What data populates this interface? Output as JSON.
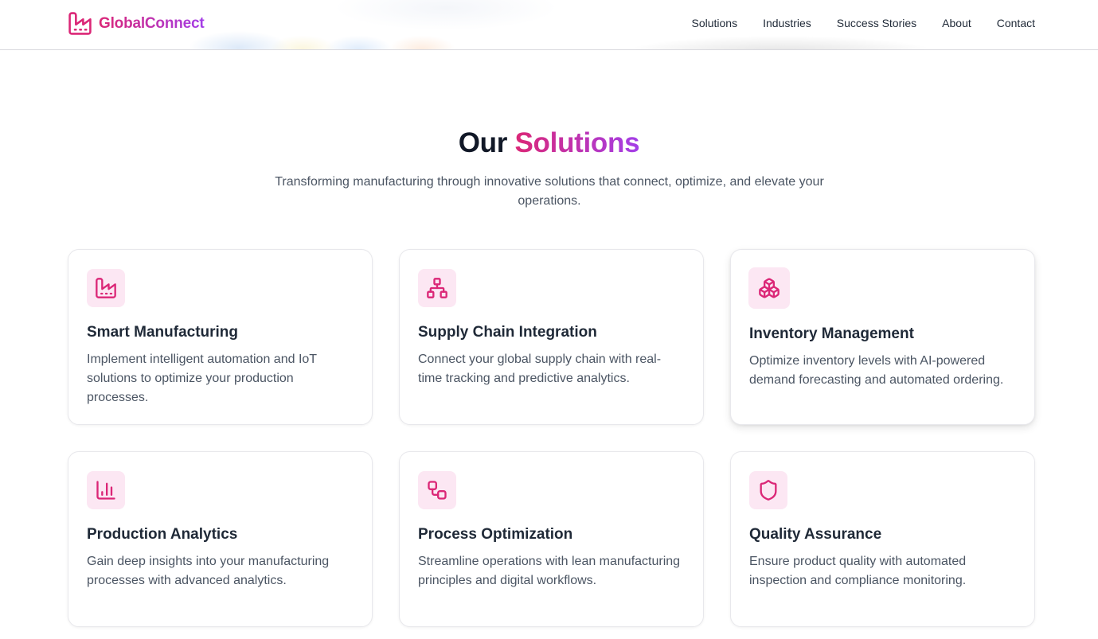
{
  "brand": {
    "name": "GlobalConnect",
    "accent_from": "#db2777",
    "accent_to": "#a33ee8",
    "icon": "factory-icon"
  },
  "nav": {
    "items": [
      {
        "label": "Solutions"
      },
      {
        "label": "Industries"
      },
      {
        "label": "Success Stories"
      },
      {
        "label": "About"
      },
      {
        "label": "Contact"
      }
    ]
  },
  "section": {
    "title_lead": "Our",
    "title_accent": "Solutions",
    "subtitle": "Transforming manufacturing through innovative solutions that connect, optimize, and elevate your operations."
  },
  "cards": [
    {
      "title": "Smart Manufacturing",
      "description": "Implement intelligent automation and IoT solutions to optimize your production processes.",
      "icon": "factory-icon"
    },
    {
      "title": "Supply Chain Integration",
      "description": "Connect your global supply chain with real-time tracking and predictive analytics.",
      "icon": "network-icon"
    },
    {
      "title": "Inventory Management",
      "description": "Optimize inventory levels with AI-powered demand forecasting and automated ordering.",
      "icon": "boxes-icon"
    },
    {
      "title": "Production Analytics",
      "description": "Gain deep insights into your manufacturing processes with advanced analytics.",
      "icon": "bar-chart-icon"
    },
    {
      "title": "Process Optimization",
      "description": "Streamline operations with lean manufacturing principles and digital workflows.",
      "icon": "workflow-icon"
    },
    {
      "title": "Quality Assurance",
      "description": "Ensure product quality with automated inspection and compliance monitoring.",
      "icon": "shield-icon"
    }
  ],
  "colors": {
    "icon_stroke": "#db2777",
    "icon_bg": "#fce7f3"
  }
}
